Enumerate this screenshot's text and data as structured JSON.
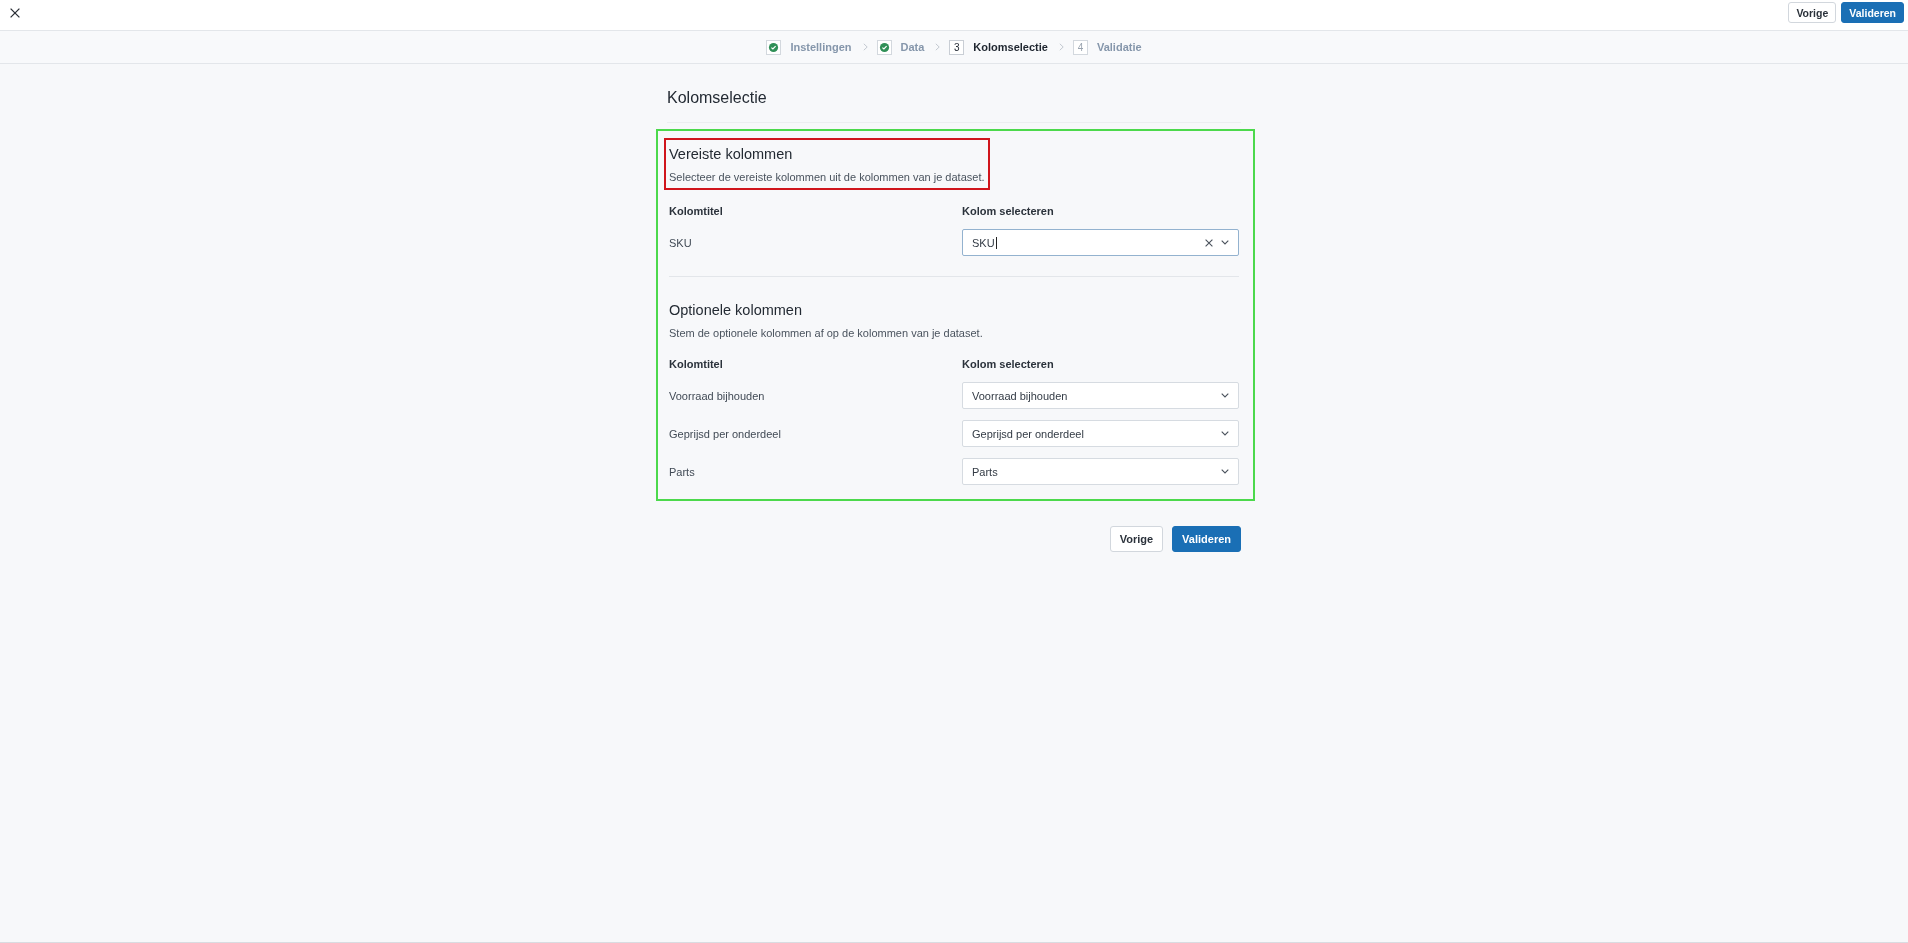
{
  "toolbar": {
    "buttons": [
      {
        "label": "Vorige",
        "kind": "secondary"
      },
      {
        "label": "Valideren",
        "kind": "primary"
      }
    ]
  },
  "stepper": {
    "steps": [
      {
        "label": "Instellingen",
        "completed": true,
        "selected": false
      },
      {
        "label": "Data",
        "completed": true,
        "selected": false
      },
      {
        "number": "3",
        "label": "Kolomselectie",
        "completed": false,
        "selected": true
      },
      {
        "number": "4",
        "label": "Validatie",
        "completed": false,
        "selected": false
      }
    ]
  },
  "page": {
    "title": "Kolomselectie"
  },
  "form": {
    "highlighted": true,
    "sections": [
      {
        "title": "Vereiste kolommen",
        "description": "Selecteer de vereiste kolommen uit de kolommen van je dataset.",
        "highlighted": true,
        "columns": [
          "Kolomtitel",
          "Kolom selecteren"
        ],
        "rows": [
          {
            "label": "SKU",
            "select": {
              "value": "SKU",
              "clearable": true,
              "focused": true
            }
          }
        ]
      },
      {
        "title": "Optionele kolommen",
        "description": "Stem de optionele kolommen af op de kolommen van je dataset.",
        "highlighted": false,
        "columns": [
          "Kolomtitel",
          "Kolom selecteren"
        ],
        "rows": [
          {
            "label": "Voorraad bijhouden",
            "select": {
              "value": "Voorraad bijhouden",
              "clearable": false,
              "focused": false
            }
          },
          {
            "label": "Geprijsd per onderdeel",
            "select": {
              "value": "Geprijsd per onderdeel",
              "clearable": false,
              "focused": false
            }
          },
          {
            "label": "Parts",
            "select": {
              "value": "Parts",
              "clearable": false,
              "focused": false
            }
          }
        ]
      }
    ]
  },
  "footer_buttons": [
    {
      "label": "Vorige",
      "kind": "secondary"
    },
    {
      "label": "Valideren",
      "kind": "primary"
    }
  ]
}
